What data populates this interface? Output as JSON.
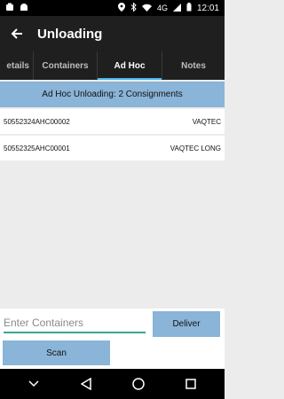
{
  "status_bar": {
    "time": "12:01",
    "network": "4G",
    "colors": {
      "background": "#000000",
      "icons": "#ffffff"
    },
    "icons": [
      "notification-icon",
      "android-icon",
      "location-icon",
      "bluetooth-icon",
      "wifi-icon",
      "signal-icon",
      "battery-icon"
    ]
  },
  "app_bar": {
    "title": "Unloading",
    "back_icon": "arrow-left-icon",
    "colors": {
      "background": "#1f1f1f",
      "title": "#ffffff"
    }
  },
  "tabs": [
    {
      "label": "etails",
      "active": false
    },
    {
      "label": "Containers",
      "active": false
    },
    {
      "label": "Ad Hoc",
      "active": true
    },
    {
      "label": "Notes",
      "active": false
    }
  ],
  "banner": {
    "text": "Ad Hoc Unloading: 2 Consignments",
    "color": "#8ab4d8"
  },
  "consignments": [
    {
      "id": "50552324AHC00002",
      "name": "VAQTEC"
    },
    {
      "id": "50552325AHC00001",
      "name": "VAQTEC LONG"
    }
  ],
  "input": {
    "placeholder": "Enter Containers",
    "value": ""
  },
  "buttons": {
    "deliver": "Deliver",
    "scan": "Scan",
    "color": "#8ab4d8"
  },
  "accent_color": "#4db6e8",
  "nav_bar": {
    "icons": [
      "chevron-down-icon",
      "back-triangle-icon",
      "home-circle-icon",
      "recents-square-icon"
    ]
  }
}
